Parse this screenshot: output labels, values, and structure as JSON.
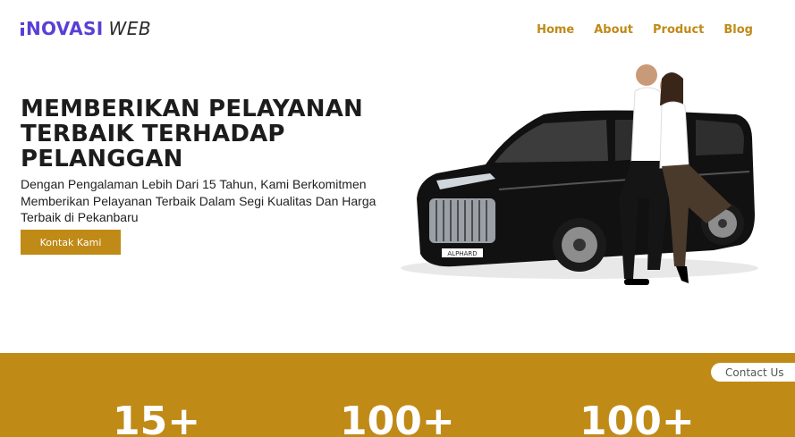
{
  "logo": {
    "bold": "NOVASI",
    "light": "WEB"
  },
  "nav": [
    "Home",
    "About",
    "Product",
    "Blog"
  ],
  "hero": {
    "title": "MEMBERIKAN PELAYANAN TERBAIK TERHADAP PELANGGAN",
    "subtitle": "Dengan Pengalaman Lebih Dari 15 Tahun, Kami Berkomitmen Memberikan Pelayanan Terbaik Dalam Segi Kualitas Dan Harga Terbaik di Pekanbaru",
    "cta_label": "Kontak Kami",
    "plate_text": "ALPHARD"
  },
  "contact_pill": "Contact Us",
  "stats": [
    "15+",
    "100+",
    "100+"
  ],
  "colors": {
    "brand": "#5a3fd6",
    "accent": "#c08a17",
    "text": "#1c1c1c"
  }
}
